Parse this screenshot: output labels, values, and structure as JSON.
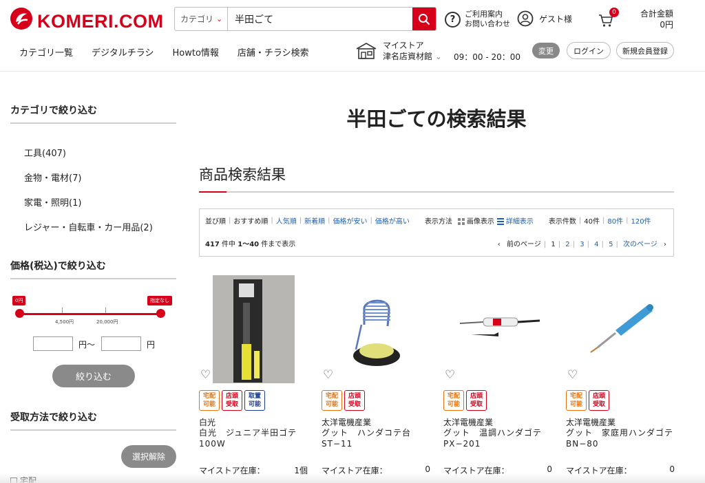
{
  "header": {
    "logo_text": "KOMERI.COM",
    "search": {
      "category_label": "カテゴリ",
      "query": "半田ごて"
    },
    "help": {
      "line1": "ご利用案内",
      "line2": "お問い合わせ"
    },
    "guest_label": "ゲスト様",
    "cart_count": "0",
    "total": {
      "label": "合計金額",
      "value": "0円"
    },
    "nav": [
      "カテゴリ一覧",
      "デジタルチラシ",
      "Howto情報",
      "店舗・チラシ検索"
    ],
    "store": {
      "label": "マイストア",
      "name": "津名店資材館",
      "hours": "09：00 - 20：00"
    },
    "buttons": {
      "change": "変更",
      "login": "ログイン",
      "register": "新規会員登録"
    },
    "accent_color": "#d7001b"
  },
  "sidebar": {
    "category_heading": "カテゴリで絞り込む",
    "categories": [
      "工具(407)",
      "金物・電材(7)",
      "家電・照明(1)",
      "レジャー・自転車・カー用品(2)"
    ],
    "price_heading": "価格(税込)で絞り込む",
    "slider": {
      "min_tag": "0円",
      "max_tag": "指定なし",
      "tick1": "4,500円",
      "tick2": "20,000円"
    },
    "price_unit_from": "円〜",
    "price_unit_to": "円",
    "narrow_button": "絞り込む",
    "receive_heading": "受取方法で絞り込む",
    "clear_button": "選択解除",
    "receive_option": "宅配"
  },
  "main": {
    "title": "半田ごての検索結果",
    "section_title": "商品検索結果",
    "sort": {
      "label": "並び順",
      "options": [
        "おすすめ順",
        "人気順",
        "新着順",
        "価格が安い",
        "価格が高い"
      ],
      "view_label": "表示方法",
      "view_image": "画像表示",
      "view_detail": "詳細表示",
      "count_label": "表示件数",
      "counts": [
        "40件",
        "80件",
        "120件"
      ]
    },
    "result_info": {
      "total": "417",
      "mid": " 件中 ",
      "range": "1〜40",
      "tail": " 件まで表示"
    },
    "pager": {
      "prev": "前のページ",
      "pages": [
        "1",
        "2",
        "3",
        "4",
        "5"
      ],
      "next": "次のページ"
    }
  },
  "products": [
    {
      "maker": "白光",
      "name": "白光　ジュニア半田ゴテ　100W",
      "stock_label": "マイストア在庫：",
      "stock": "1個",
      "badges": [
        [
          "宅配",
          "可能"
        ],
        [
          "店頭",
          "受取"
        ],
        [
          "取置",
          "可能"
        ]
      ]
    },
    {
      "maker": "太洋電機産業",
      "name": "グット　ハンダコテ台　ST−11",
      "stock_label": "マイストア在庫：",
      "stock": "0",
      "badges": [
        [
          "宅配",
          "可能"
        ],
        [
          "店頭",
          "受取"
        ]
      ]
    },
    {
      "maker": "太洋電機産業",
      "name": "グット　温調ハンダゴテ　PX−201",
      "stock_label": "マイストア在庫：",
      "stock": "0",
      "badges": [
        [
          "宅配",
          "可能"
        ],
        [
          "店頭",
          "受取"
        ]
      ]
    },
    {
      "maker": "太洋電機産業",
      "name": "グット　家庭用ハンダゴテ　BN−80",
      "stock_label": "マイストア在庫：",
      "stock": "0",
      "badges": [
        [
          "宅配",
          "可能"
        ],
        [
          "店頭",
          "受取"
        ]
      ]
    }
  ]
}
